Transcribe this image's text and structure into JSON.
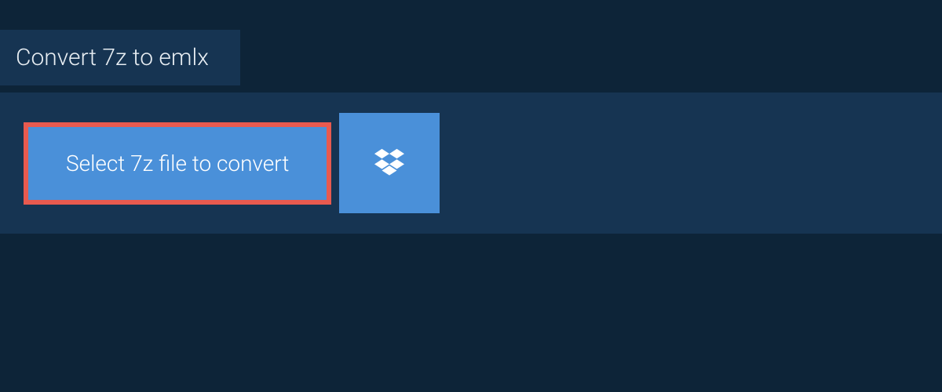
{
  "header": {
    "tab_label": "Convert 7z to emlx"
  },
  "actions": {
    "select_file_label": "Select 7z file to convert"
  }
}
